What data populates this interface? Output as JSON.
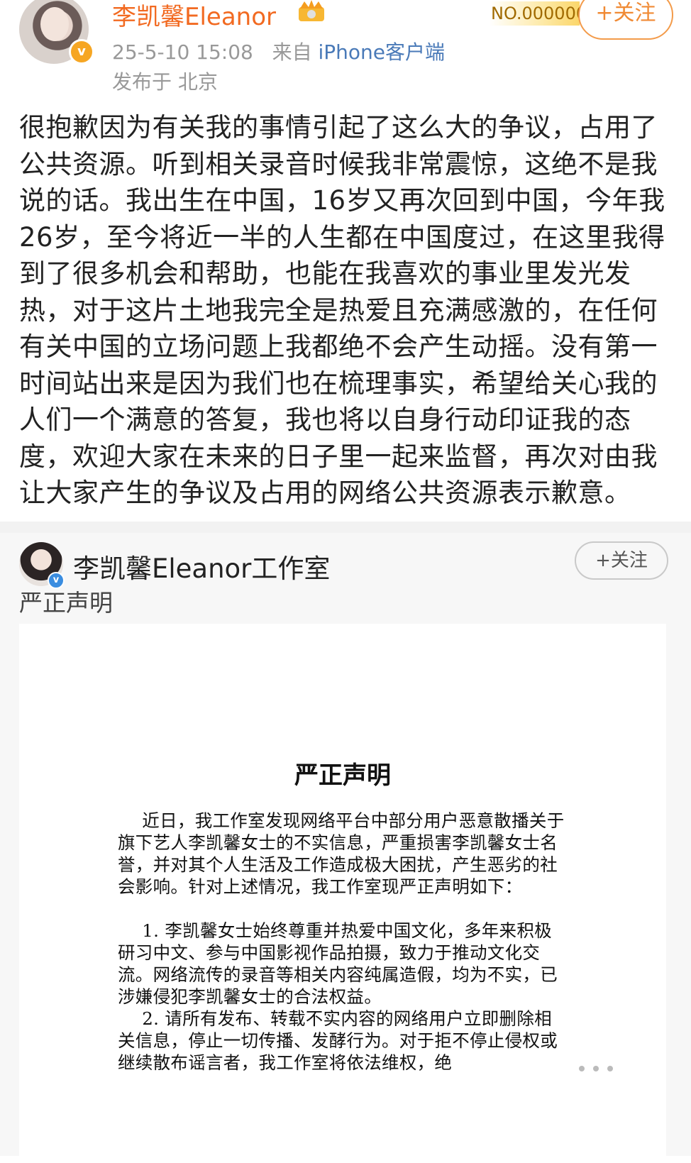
{
  "post1": {
    "author": "李凯馨Eleanor",
    "rank_tag": "NO.000000",
    "follow_label": "+关注",
    "timestamp": "25-5-10 15:08",
    "source_prefix": "来自",
    "client": "iPhone客户端",
    "location": "发布于 北京",
    "text": "很抱歉因为有关我的事情引起了这么大的争议，占用了公共资源。听到相关录音时候我非常震惊，这绝不是我说的话。我出生在中国，16岁又再次回到中国，今年我26岁，至今将近一半的人生都在中国度过，在这里我得到了很多机会和帮助，也能在我喜欢的事业里发光发热，对于这片土地我完全是热爱且充满感激的，在任何有关中国的立场问题上我都绝不会产生动摇。没有第一时间站出来是因为我们也在梳理事实，希望给关心我的人们一个满意的答复，我也将以自身行动印证我的态度，欢迎大家在未来的日子里一起来监督，再次对由我让大家产生的争议及占用的网络公共资源表示歉意。"
  },
  "post2": {
    "author": "李凯馨Eleanor工作室",
    "follow_label": "+关注",
    "caption": "严正声明",
    "document": {
      "title": "严正声明",
      "intro": "近日，我工作室发现网络平台中部分用户恶意散播关于旗下艺人李凯馨女士的不实信息，严重损害李凯馨女士名誉，并对其个人生活及工作造成极大困扰，产生恶劣的社会影响。针对上述情况，我工作室现严正声明如下：",
      "item1": "1. 李凯馨女士始终尊重并热爱中国文化，多年来积极研习中文、参与中国影视作品拍摄，致力于推动文化交流。网络流传的录音等相关内容纯属造假，均为不实，已涉嫌侵犯李凯馨女士的合法权益。",
      "item2": "2. 请所有发布、转载不实内容的网络用户立即删除相关信息，停止一切传播、发酵行为。对于拒不停止侵权或继续散布谣言者，我工作室将依法维权，绝"
    }
  },
  "colors": {
    "author_orange": "#f26a21",
    "client_blue": "#4a7ab8",
    "verified_gold": "#f6a623",
    "verified_blue": "#3a8de0"
  }
}
